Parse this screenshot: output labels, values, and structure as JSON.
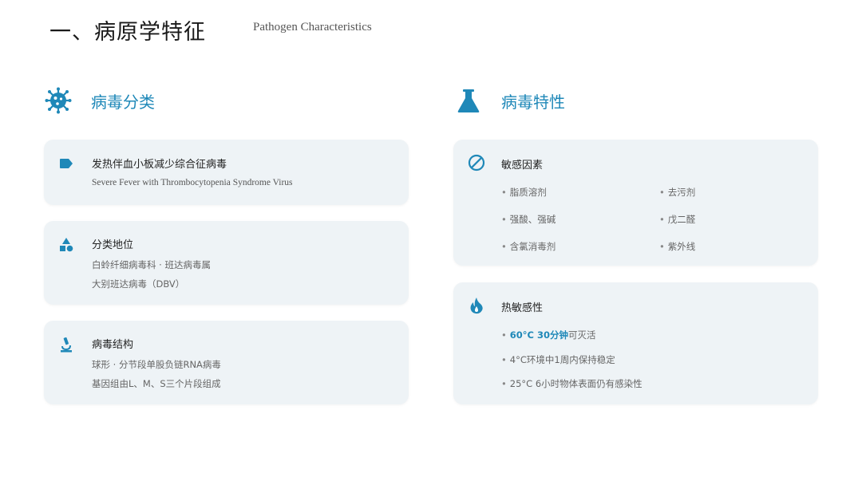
{
  "header": {
    "title": "一、病原学特征",
    "subtitle": "Pathogen Characteristics"
  },
  "left_section": {
    "label": "病毒分类",
    "icon": "virus-icon",
    "cards": [
      {
        "icon": "tag-icon",
        "title": "发热伴血小板减少综合征病毒",
        "lines": [
          "Severe Fever with Thrombocytopenia Syndrome Virus"
        ]
      },
      {
        "icon": "shapes-icon",
        "title": "分类地位",
        "lines": [
          "白蛉纤细病毒科 · 班达病毒属",
          "大别班达病毒（DBV）"
        ]
      },
      {
        "icon": "microscope-icon",
        "title": "病毒结构",
        "lines": [
          "球形 · 分节段单股负链RNA病毒",
          "基因组由L、M、S三个片段组成"
        ]
      }
    ]
  },
  "right_section": {
    "label": "病毒特性",
    "icon": "flask-icon",
    "sensitivity": {
      "icon": "ban-icon",
      "title": "敏感因素",
      "items": [
        "脂质溶剂",
        "去污剂",
        "强酸、强碱",
        "戊二醛",
        "含氯消毒剂",
        "紫外线"
      ]
    },
    "heat": {
      "icon": "flame-icon",
      "title": "热敏感性",
      "highlight": "60°C 30分钟",
      "highlight_rest": "可灭活",
      "items": [
        "4°C环境中1周内保持稳定",
        "25°C 6小时物体表面仍有感染性"
      ]
    }
  },
  "colors": {
    "accent": "#1f88b8",
    "card_bg": "#eef3f6"
  }
}
